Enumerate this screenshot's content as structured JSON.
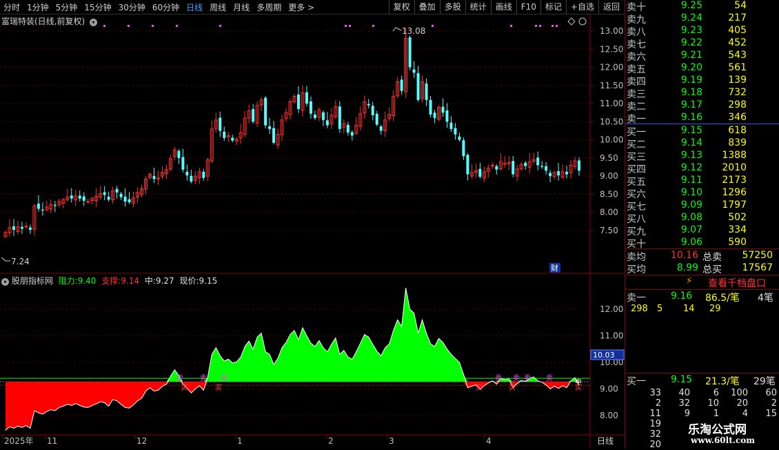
{
  "toolbar": {
    "periods": [
      "分时",
      "1分钟",
      "5分钟",
      "15分钟",
      "30分钟",
      "60分钟",
      "日线",
      "周线",
      "月线",
      "多周期",
      "更多 >"
    ],
    "active_period": "日线",
    "buttons": [
      "复权",
      "叠加",
      "多股",
      "统计",
      "画线",
      "F10",
      "标记",
      "+自选",
      "返回"
    ]
  },
  "main_chart": {
    "title": "富瑞特装(日线,前复权)",
    "high_label": "13.08",
    "low_label": "7.24",
    "fin_badge": "财",
    "y_ticks": [
      "13.00",
      "12.50",
      "12.00",
      "11.50",
      "11.00",
      "10.50",
      "10.00",
      "9.50",
      "9.00",
      "8.50",
      "8.00",
      "7.50"
    ]
  },
  "indicator": {
    "name": "股朋指标网",
    "resist_label": "阻力:",
    "resist_value": "9.40",
    "support_label": "支撑:",
    "support_value": "9.14",
    "mid_label": "中:",
    "mid_value": "9.27",
    "price_label": "现价:",
    "price_value": "9.15",
    "y_ticks": [
      "12.00",
      "11.00",
      "10.00",
      "9.00",
      "8.00"
    ],
    "cursor_value": "10.03",
    "marker_sell": "卖",
    "marker_buy": "买",
    "marker_mid": "中"
  },
  "time_axis": {
    "labels": [
      "2025年",
      "11",
      "12",
      "1",
      "2",
      "3",
      "4"
    ],
    "period": "日线"
  },
  "order_book": {
    "asks": [
      {
        "label": "卖十",
        "price": "9.25",
        "vol": "54"
      },
      {
        "label": "卖九",
        "price": "9.24",
        "vol": "217"
      },
      {
        "label": "卖八",
        "price": "9.23",
        "vol": "405"
      },
      {
        "label": "卖七",
        "price": "9.22",
        "vol": "452"
      },
      {
        "label": "卖六",
        "price": "9.21",
        "vol": "543"
      },
      {
        "label": "卖五",
        "price": "9.20",
        "vol": "561"
      },
      {
        "label": "卖四",
        "price": "9.19",
        "vol": "139"
      },
      {
        "label": "卖三",
        "price": "9.18",
        "vol": "732"
      },
      {
        "label": "卖二",
        "price": "9.17",
        "vol": "298"
      },
      {
        "label": "卖一",
        "price": "9.16",
        "vol": "346"
      }
    ],
    "bids": [
      {
        "label": "买一",
        "price": "9.15",
        "vol": "618"
      },
      {
        "label": "买二",
        "price": "9.14",
        "vol": "839"
      },
      {
        "label": "买三",
        "price": "9.13",
        "vol": "1388"
      },
      {
        "label": "买四",
        "price": "9.12",
        "vol": "2010"
      },
      {
        "label": "买五",
        "price": "9.11",
        "vol": "2173"
      },
      {
        "label": "买六",
        "price": "9.10",
        "vol": "1296"
      },
      {
        "label": "买七",
        "price": "9.09",
        "vol": "1797"
      },
      {
        "label": "买八",
        "price": "9.08",
        "vol": "502"
      },
      {
        "label": "买九",
        "price": "9.07",
        "vol": "334"
      },
      {
        "label": "买十",
        "price": "9.06",
        "vol": "590"
      }
    ],
    "avg_sell_label": "卖均",
    "avg_sell": "10.16",
    "total_sell_label": "总卖",
    "total_sell": "57250",
    "avg_buy_label": "买均",
    "avg_buy": "8.99",
    "total_buy_label": "总买",
    "total_buy": "17567",
    "qianfang_button": "查看千档盘口",
    "sell1": {
      "label": "卖一",
      "price": "9.16",
      "detail": "86.5/笔",
      "count": "4笔",
      "orders": [
        "298",
        "5",
        "14",
        "29"
      ]
    },
    "buy1": {
      "label": "买一",
      "price": "9.15",
      "detail": "21.3/笔",
      "count": "29笔",
      "orders": [
        [
          "33",
          "40",
          "6",
          "100",
          "60"
        ],
        [
          "2",
          "32",
          "10",
          "20",
          "2"
        ],
        [
          "11",
          "9",
          "1",
          "4",
          "15"
        ],
        [
          "19"
        ],
        [
          "32"
        ],
        [
          "20"
        ]
      ]
    }
  },
  "watermark": {
    "line1": "乐淘公式网",
    "line2": "www.60lt.com"
  },
  "colors": {
    "up": "#ff3030",
    "down": "#54ffff",
    "green_fill": "#00ff00",
    "red_fill": "#ff0000",
    "grid": "#8b0000"
  }
}
